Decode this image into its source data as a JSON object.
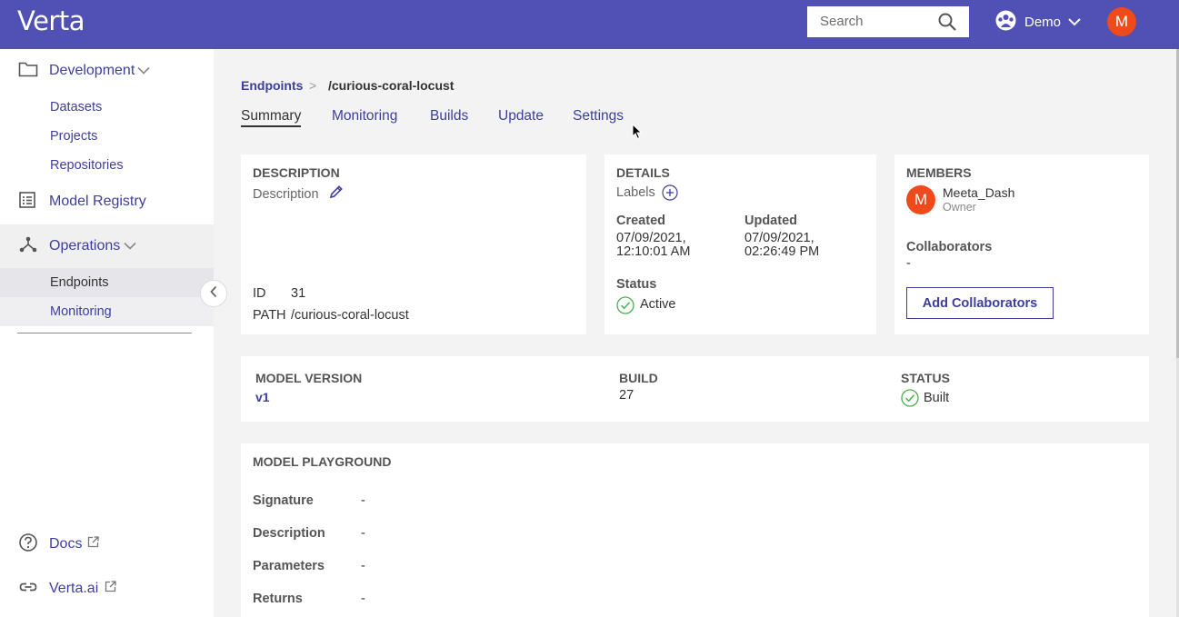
{
  "header": {
    "logo": "Verta",
    "search_placeholder": "Search",
    "workspace": "Demo",
    "user_initial": "M"
  },
  "sidebar": {
    "development": {
      "label": "Development",
      "items": [
        "Datasets",
        "Projects",
        "Repositories"
      ]
    },
    "model_registry": "Model Registry",
    "operations": {
      "label": "Operations",
      "items": [
        "Endpoints",
        "Monitoring"
      ]
    },
    "docs": "Docs",
    "verta_ai": "Verta.ai"
  },
  "breadcrumb": {
    "root": "Endpoints",
    "separator": ">",
    "current": "/curious-coral-locust"
  },
  "tabs": [
    "Summary",
    "Monitoring",
    "Builds",
    "Update",
    "Settings"
  ],
  "active_tab": "Summary",
  "description_card": {
    "heading": "DESCRIPTION",
    "description": "Description",
    "id_label": "ID",
    "id_value": "31",
    "path_label": "PATH",
    "path_value": "/curious-coral-locust"
  },
  "details_card": {
    "heading": "DETAILS",
    "labels": "Labels",
    "created_label": "Created",
    "created_date": "07/09/2021,",
    "created_time": "12:10:01 AM",
    "updated_label": "Updated",
    "updated_date": "07/09/2021,",
    "updated_time": "02:26:49 PM",
    "status_label": "Status",
    "status_value": "Active"
  },
  "members_card": {
    "heading": "MEMBERS",
    "member_initial": "M",
    "member_name": "Meeta_Dash",
    "member_role": "Owner",
    "collaborators_label": "Collaborators",
    "collaborators_value": "-",
    "add_button": "Add Collaborators"
  },
  "version_card": {
    "model_version_label": "MODEL VERSION",
    "model_version_value": "v1",
    "build_label": "BUILD",
    "build_value": "27",
    "status_label": "STATUS",
    "status_value": "Built"
  },
  "playground": {
    "heading": "MODEL PLAYGROUND",
    "rows": [
      {
        "label": "Signature",
        "value": "-"
      },
      {
        "label": "Description",
        "value": "-"
      },
      {
        "label": "Parameters",
        "value": "-"
      },
      {
        "label": "Returns",
        "value": "-"
      }
    ]
  },
  "colors": {
    "brand": "#5050b5",
    "link": "#3e3e9e",
    "avatar": "#ee4a1b",
    "success": "#4caf50"
  }
}
